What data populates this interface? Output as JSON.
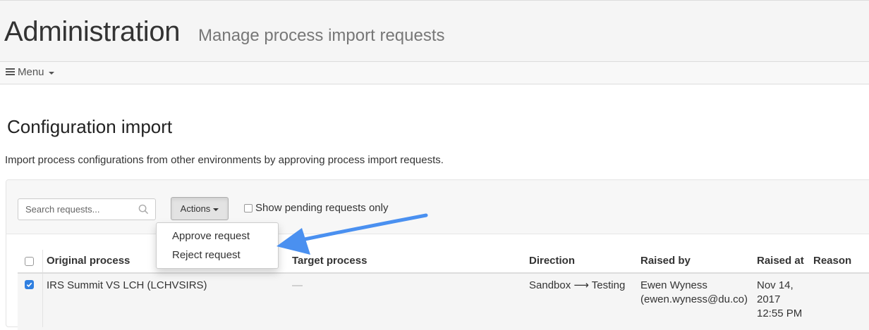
{
  "header": {
    "title": "Administration",
    "subtitle": "Manage process import requests"
  },
  "menu": {
    "label": "Menu"
  },
  "section": {
    "title": "Configuration import",
    "description": "Import process configurations from other environments by approving process import requests."
  },
  "toolbar": {
    "search_placeholder": "Search requests...",
    "actions_label": "Actions",
    "pending_label": "Show pending requests only"
  },
  "dropdown": {
    "items": [
      "Approve request",
      "Reject request"
    ]
  },
  "table": {
    "columns": [
      "Original process",
      "Target process",
      "Direction",
      "Raised by",
      "Raised at",
      "Reason"
    ],
    "rows": [
      {
        "checked": true,
        "original_process": "IRS Summit VS LCH (LCHVSIRS)",
        "target_process": "—",
        "direction": "Sandbox ⟶ Testing",
        "raised_by_name": "Ewen Wyness",
        "raised_by_email": "(ewen.wyness@du.co)",
        "raised_at_date": "Nov 14,",
        "raised_at_year": "2017",
        "raised_at_time": "12:55 PM",
        "reason": ""
      }
    ]
  },
  "colors": {
    "accent": "#2f7fe0",
    "annotation_arrow": "#4a90f0"
  }
}
